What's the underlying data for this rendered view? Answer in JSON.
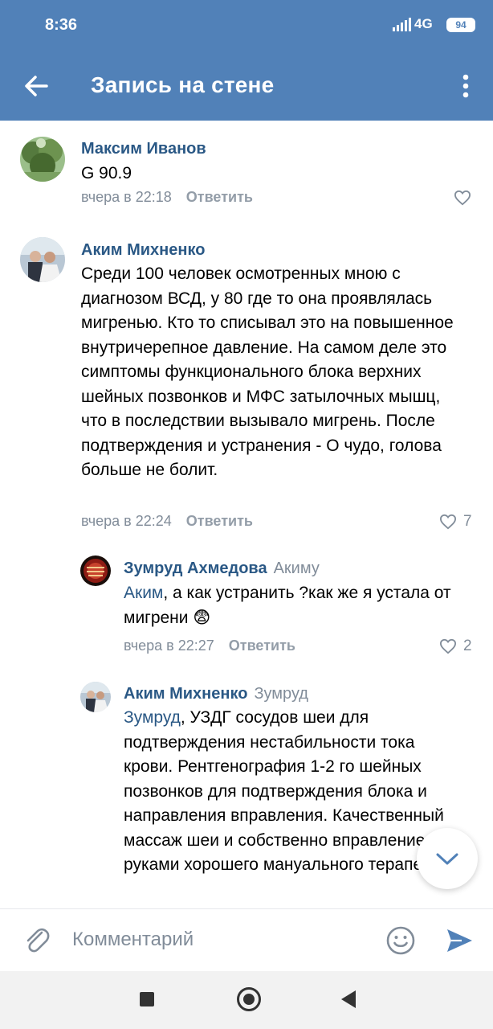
{
  "status_bar": {
    "time": "8:36",
    "network": "4G",
    "battery": "94"
  },
  "header": {
    "title": "Запись на стене"
  },
  "comments": [
    {
      "author": "Максим Иванов",
      "text": "G 90.9",
      "time": "вчера в 22:18",
      "reply_label": "Ответить",
      "likes": ""
    },
    {
      "author": "Аким Михненко",
      "text": "Среди 100 человек осмотренных мною с диагнозом ВСД, у 80 где то она проявлялась мигренью. Кто то списывал это на повышенное внутричерепное давление. На самом деле это симптомы функционального блока верхних шейных позвонков и МФС затылочных мышц, что в последствии вызывало мигрень. После подтверждения и устранения - О чудо, голова больше не болит.",
      "time": "вчера в 22:24",
      "reply_label": "Ответить",
      "likes": "7"
    },
    {
      "author": "Зумруд Ахмедова",
      "reply_to": "Акиму",
      "mention": "Аким",
      "text": ", а как устранить ?как же я устала от мигрени 😨",
      "time": "вчера в 22:27",
      "reply_label": "Ответить",
      "likes": "2"
    },
    {
      "author": "Аким Михненко",
      "reply_to": "Зумруд",
      "mention": "Зумруд",
      "text": ", УЗДГ сосудов шеи для подтверждения нестабильности тока крови. Рентгенография 1-2 го шейных позвонков для подтверждения блока и направления вправления. Качественный массаж шеи и собственно вправление руками хорошего мануального терапевта,"
    }
  ],
  "composer": {
    "placeholder": "Комментарий"
  },
  "colors": {
    "accent": "#5181b8",
    "link": "#2a5885",
    "secondary": "#818c99"
  }
}
